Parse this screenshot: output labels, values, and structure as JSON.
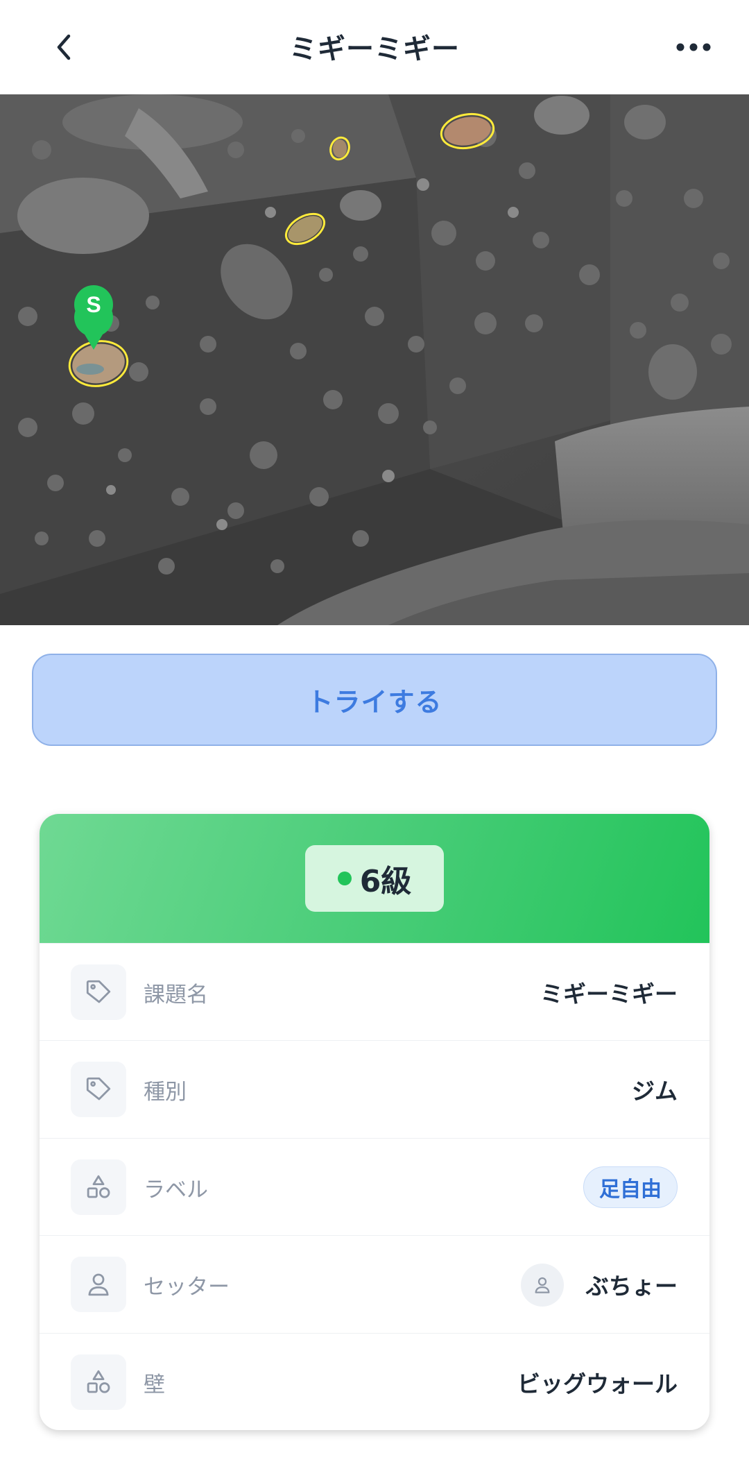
{
  "header": {
    "title": "ミギーミギー",
    "back_icon": "chevron-left-icon",
    "more_icon": "more-horizontal-icon"
  },
  "photo": {
    "start_marker": "S",
    "accent_color": "#22c45a",
    "highlight_color": "#ffeb3b"
  },
  "try_button": {
    "label": "トライする"
  },
  "grade": {
    "label": "6級",
    "dot_color": "#22c45a"
  },
  "details": [
    {
      "icon": "tag-icon",
      "label": "課題名",
      "value": "ミギーミギー"
    },
    {
      "icon": "tag-icon",
      "label": "種別",
      "value": "ジム"
    },
    {
      "icon": "shapes-icon",
      "label": "ラベル",
      "tag": "足自由"
    },
    {
      "icon": "user-icon",
      "label": "セッター",
      "value": "ぶちょー"
    },
    {
      "icon": "shapes-icon",
      "label": "壁",
      "value": "ビッグウォール"
    }
  ]
}
